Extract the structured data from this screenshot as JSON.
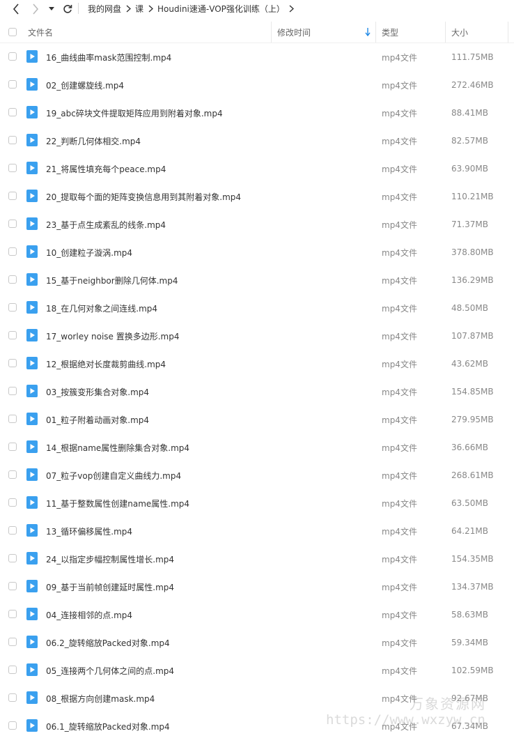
{
  "breadcrumb": [
    "我的网盘",
    "课",
    "Houdini速通-VOP强化训练（上）"
  ],
  "columns": {
    "name": "文件名",
    "modified": "修改时间",
    "type": "类型",
    "size": "大小"
  },
  "colors": {
    "file_icon": "#3aa0ef",
    "sort_arrow": "#1e88e5"
  },
  "files": [
    {
      "name": "16_曲线曲率mask范围控制.mp4",
      "type": "mp4文件",
      "size": "111.75MB"
    },
    {
      "name": "02_创建螺旋线.mp4",
      "type": "mp4文件",
      "size": "272.46MB"
    },
    {
      "name": "19_abc碎块文件提取矩阵应用到附着对象.mp4",
      "type": "mp4文件",
      "size": "88.41MB"
    },
    {
      "name": "22_判断几何体相交.mp4",
      "type": "mp4文件",
      "size": "82.57MB"
    },
    {
      "name": "21_将属性填充每个peace.mp4",
      "type": "mp4文件",
      "size": "63.90MB"
    },
    {
      "name": "20_提取每个面的矩阵变换信息用到其附着对象.mp4",
      "type": "mp4文件",
      "size": "110.21MB"
    },
    {
      "name": "23_基于点生成紊乱的线条.mp4",
      "type": "mp4文件",
      "size": "71.37MB"
    },
    {
      "name": "10_创建粒子漩涡.mp4",
      "type": "mp4文件",
      "size": "378.80MB"
    },
    {
      "name": "15_基于neighbor删除几何体.mp4",
      "type": "mp4文件",
      "size": "136.29MB"
    },
    {
      "name": "18_在几何对象之间连线.mp4",
      "type": "mp4文件",
      "size": "48.50MB"
    },
    {
      "name": "17_worley noise 置换多边形.mp4",
      "type": "mp4文件",
      "size": "107.87MB"
    },
    {
      "name": "12_根据绝对长度裁剪曲线.mp4",
      "type": "mp4文件",
      "size": "43.62MB"
    },
    {
      "name": "03_按簇变形集合对象.mp4",
      "type": "mp4文件",
      "size": "154.85MB"
    },
    {
      "name": "01_粒子附着动画对象.mp4",
      "type": "mp4文件",
      "size": "279.95MB"
    },
    {
      "name": "14_根据name属性删除集合对象.mp4",
      "type": "mp4文件",
      "size": "36.66MB"
    },
    {
      "name": "07_粒子vop创建自定义曲线力.mp4",
      "type": "mp4文件",
      "size": "268.61MB"
    },
    {
      "name": "11_基于整数属性创建name属性.mp4",
      "type": "mp4文件",
      "size": "63.50MB"
    },
    {
      "name": "13_循环偏移属性.mp4",
      "type": "mp4文件",
      "size": "64.21MB"
    },
    {
      "name": "24_以指定步幅控制属性增长.mp4",
      "type": "mp4文件",
      "size": "154.35MB"
    },
    {
      "name": "09_基于当前帧创建延时属性.mp4",
      "type": "mp4文件",
      "size": "134.37MB"
    },
    {
      "name": "04_连接相邻的点.mp4",
      "type": "mp4文件",
      "size": "58.63MB"
    },
    {
      "name": "06.2_旋转缩放Packed对象.mp4",
      "type": "mp4文件",
      "size": "59.34MB"
    },
    {
      "name": "05_连接两个几何体之间的点.mp4",
      "type": "mp4文件",
      "size": "102.59MB"
    },
    {
      "name": "08_根据方向创建mask.mp4",
      "type": "mp4文件",
      "size": "92.67MB"
    },
    {
      "name": "06.1_旋转缩放Packed对象.mp4",
      "type": "mp4文件",
      "size": "67.34MB"
    }
  ],
  "watermark": {
    "title": "万象资源网",
    "url": "https://www.wxzyw.cn"
  }
}
